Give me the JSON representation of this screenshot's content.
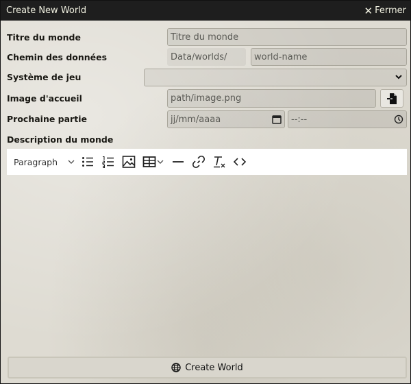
{
  "window": {
    "title": "Create New World",
    "close_label": "Fermer"
  },
  "form": {
    "title": {
      "label": "Titre du monde",
      "placeholder": "Titre du monde"
    },
    "data_path": {
      "label": "Chemin des données",
      "prefix": "Data/worlds/",
      "placeholder": "world-name"
    },
    "system": {
      "label": "Système de jeu",
      "value": ""
    },
    "background": {
      "label": "Image d'accueil",
      "placeholder": "path/image.png"
    },
    "next_session": {
      "label": "Prochaine partie",
      "date_placeholder": "jj/mm/aaaa",
      "time_placeholder": "--:--"
    },
    "description": {
      "label": "Description du monde"
    }
  },
  "editor": {
    "format_label": "Paragraph"
  },
  "submit": {
    "label": "Create World"
  }
}
